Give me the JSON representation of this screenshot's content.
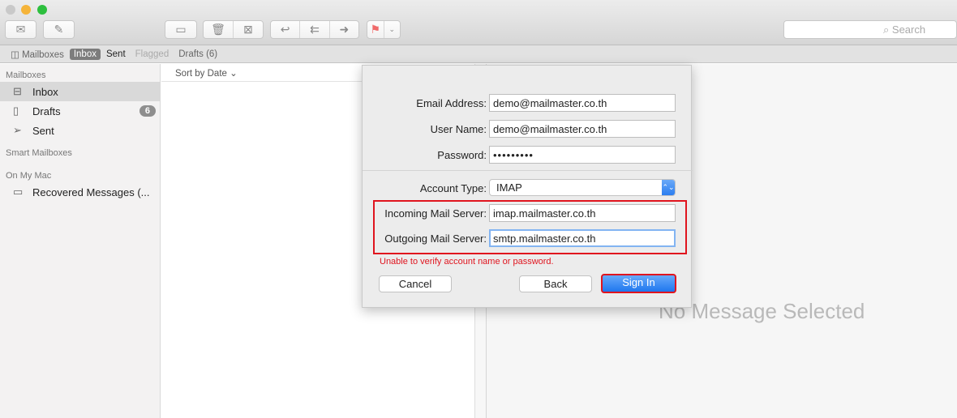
{
  "window": {
    "traffic_lights": {
      "close": "#c9c9c9",
      "minimize": "#f5b43a",
      "zoom": "#2dbf3e"
    }
  },
  "toolbar": {
    "get_mail_icon": "envelope-icon",
    "compose_icon": "compose-icon",
    "archive_icon": "archive-icon",
    "delete_icon": "trash-icon",
    "junk_icon": "junk-icon",
    "reply_icon": "reply-icon",
    "reply_all_icon": "reply-all-icon",
    "forward_icon": "forward-icon",
    "flag_icon": "flag-icon",
    "flag_color": "#f06a6a",
    "search_placeholder": "Search"
  },
  "favorites": {
    "mailboxes": "Mailboxes",
    "inbox": "Inbox",
    "sent": "Sent",
    "flagged": "Flagged",
    "drafts": "Drafts (6)"
  },
  "sidebar": {
    "mailboxes_header": "Mailboxes",
    "items": [
      {
        "label": "Inbox",
        "icon": "inbox-icon"
      },
      {
        "label": "Drafts",
        "icon": "document-icon",
        "badge": "6"
      },
      {
        "label": "Sent",
        "icon": "paper-plane-icon"
      }
    ],
    "smart_header": "Smart Mailboxes",
    "onmymac_header": "On My Mac",
    "local_items": [
      {
        "label": "Recovered Messages (...",
        "icon": "folder-icon"
      }
    ]
  },
  "list": {
    "sort_label": "Sort by Date"
  },
  "viewer": {
    "empty_text": "No Message Selected"
  },
  "dialog": {
    "email_label": "Email Address:",
    "email_value": "demo@mailmaster.co.th",
    "username_label": "User Name:",
    "username_value": "demo@mailmaster.co.th",
    "password_label": "Password:",
    "password_value": "•••••••••",
    "account_type_label": "Account Type:",
    "account_type_value": "IMAP",
    "incoming_label": "Incoming Mail Server:",
    "incoming_value": "imap.mailmaster.co.th",
    "outgoing_label": "Outgoing Mail Server:",
    "outgoing_value": "smtp.mailmaster.co.th",
    "error": "Unable to verify account name or password.",
    "cancel": "Cancel",
    "back": "Back",
    "sign_in": "Sign In",
    "highlight_color": "#e0141e"
  }
}
